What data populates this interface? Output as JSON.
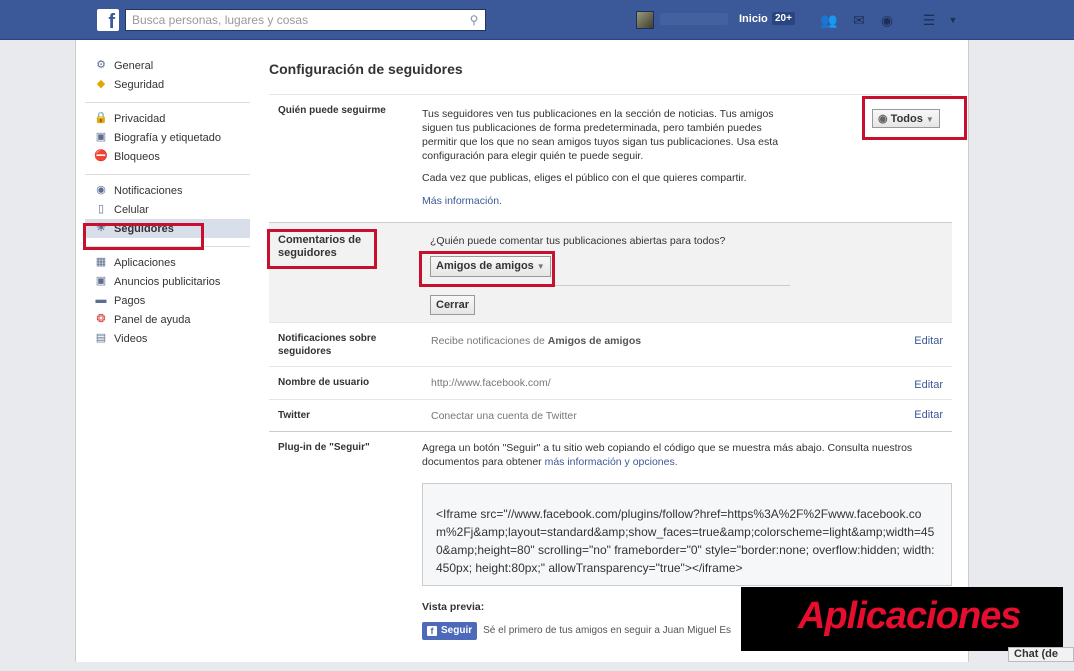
{
  "topbar": {
    "logo": "f",
    "search_placeholder": "Busca personas, lugares y cosas",
    "home_label": "Inicio",
    "home_count": "20+"
  },
  "sidebar": {
    "groups": [
      [
        {
          "label": "General",
          "icon": "gear-icon"
        },
        {
          "label": "Seguridad",
          "icon": "badge-icon"
        }
      ],
      [
        {
          "label": "Privacidad",
          "icon": "lock-icon"
        },
        {
          "label": "Biografía y etiquetado",
          "icon": "timeline-icon"
        },
        {
          "label": "Bloqueos",
          "icon": "block-icon"
        }
      ],
      [
        {
          "label": "Notificaciones",
          "icon": "globe-icon"
        },
        {
          "label": "Celular",
          "icon": "mobile-icon"
        },
        {
          "label": "Seguidores",
          "icon": "rss-icon",
          "active": true
        }
      ],
      [
        {
          "label": "Aplicaciones",
          "icon": "apps-icon"
        },
        {
          "label": "Anuncios publicitarios",
          "icon": "ads-icon"
        },
        {
          "label": "Pagos",
          "icon": "card-icon"
        },
        {
          "label": "Panel de ayuda",
          "icon": "lifebuoy-icon"
        },
        {
          "label": "Videos",
          "icon": "film-icon"
        }
      ]
    ]
  },
  "content": {
    "title": "Configuración de seguidores",
    "who_can_follow": {
      "label": "Quién puede seguirme",
      "text": "Tus seguidores ven tus publicaciones en la sección de noticias. Tus amigos siguen tus publicaciones de forma predeterminada, pero también puedes permitir que los que no sean amigos tuyos sigan tus publicaciones. Usa esta configuración para elegir quién te puede seguir.",
      "text2": "Cada vez que publicas, eliges el público con el que quieres compartir.",
      "more_link": "Más información.",
      "audience_button": "Todos"
    },
    "comments": {
      "label": "Comentarios de seguidores",
      "question": "¿Quién puede comentar tus publicaciones abiertas para todos?",
      "dropdown": "Amigos de amigos",
      "close_button": "Cerrar"
    },
    "notifications": {
      "label": "Notificaciones sobre seguidores",
      "prefix": "Recibe notificaciones de ",
      "value": "Amigos de amigos",
      "edit": "Editar"
    },
    "username": {
      "label": "Nombre de usuario",
      "value": "http://www.facebook.com/",
      "edit": "Editar"
    },
    "twitter": {
      "label": "Twitter",
      "value": "Conectar una cuenta de Twitter",
      "edit": "Editar"
    },
    "plugin": {
      "label": "Plug-in de \"Seguir\"",
      "text": "Agrega un botón \"Seguir\" a tu sitio web copiando el código que se muestra más abajo. Consulta nuestros documentos para obtener ",
      "link": "más información y opciones.",
      "code": "<Iframe src=\"//www.facebook.com/plugins/follow?href=https%3A%2F%2Fwww.facebook.com%2Fj&amp;layout=standard&amp;show_faces=true&amp;colorscheme=light&amp;width=450&amp;height=80\" scrolling=\"no\" frameborder=\"0\" style=\"border:none; overflow:hidden; width:450px; height:80px;\" allowTransparency=\"true\"></iframe>",
      "preview_label": "Vista previa:",
      "follow_button": "Seguir",
      "preview_text": "Sé el primero de tus amigos en seguir a Juan Miguel Es"
    }
  },
  "overlay": {
    "watermark": "Aplicaciones",
    "chat": "Chat (de"
  }
}
